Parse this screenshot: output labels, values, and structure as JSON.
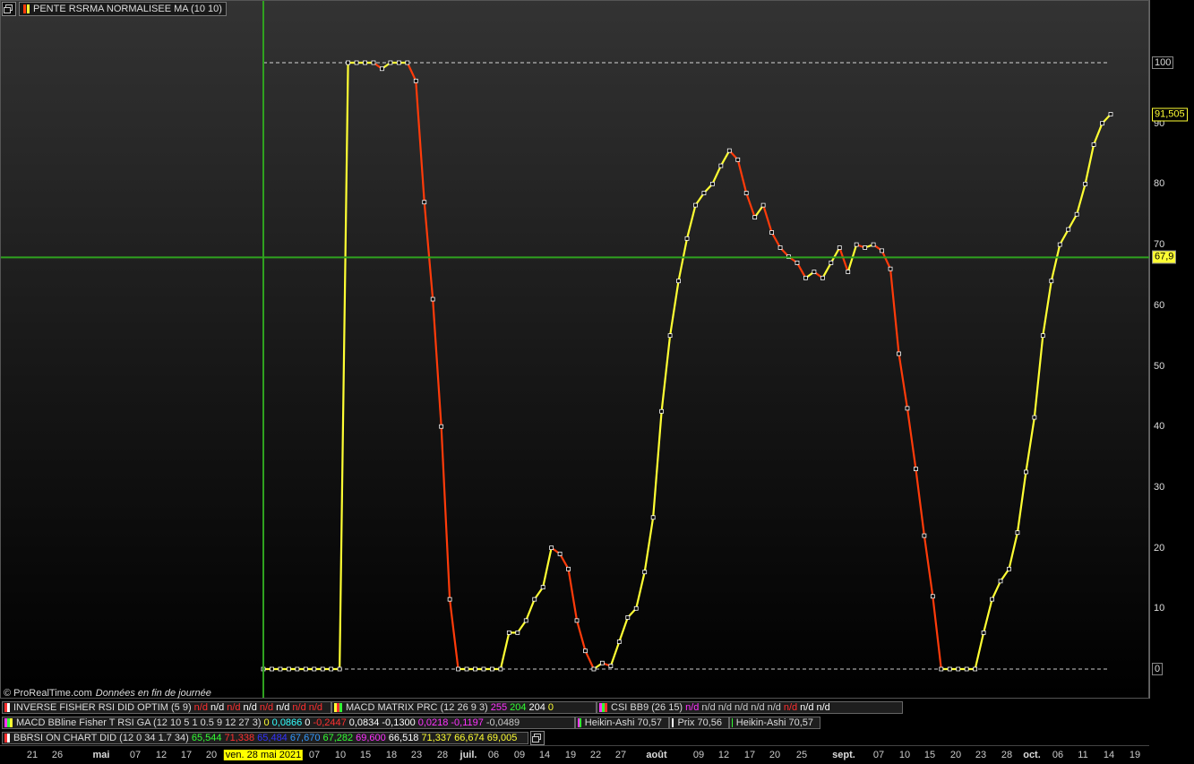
{
  "title": {
    "label": "PENTE RSRMA NORMALISEE MA (10 10)"
  },
  "copyright": {
    "brand": "© ProRealTime.com",
    "note": "Données en fin de journée"
  },
  "cursor": {
    "value_label": "67,9",
    "date_label": "ven. 28 mai 2021"
  },
  "last_value_label": "91,505",
  "colors": {
    "up": "#ffff33",
    "down": "#ff3b0a",
    "crosshair": "#2fa11f",
    "reference": "#ffffff"
  },
  "icons": {
    "window": "window-restore-icon"
  },
  "y_ticks": [
    "100",
    "90",
    "80",
    "70",
    "60",
    "50",
    "40",
    "30",
    "20",
    "10",
    "0"
  ],
  "x_ticks": [
    "21",
    "26",
    "mai",
    "07",
    "12",
    "17",
    "20",
    "ven. 28 mai 2021",
    "07",
    "10",
    "15",
    "18",
    "23",
    "28",
    "juil.",
    "06",
    "09",
    "14",
    "19",
    "22",
    "27",
    "août",
    "09",
    "12",
    "17",
    "20",
    "25",
    "sept.",
    "07",
    "10",
    "15",
    "20",
    "23",
    "28",
    "oct.",
    "06",
    "11",
    "14",
    "19"
  ],
  "indicators": {
    "row1": [
      {
        "name": "INVERSE FISHER RSI DID OPTIM (5 9)",
        "values": [
          {
            "v": "n/d",
            "c": "#ff3030"
          },
          {
            "v": "n/d",
            "c": "#ffffff"
          },
          {
            "v": "n/d",
            "c": "#ff3030"
          },
          {
            "v": "n/d",
            "c": "#ffffff"
          },
          {
            "v": "n/d",
            "c": "#ff3030"
          },
          {
            "v": "n/d",
            "c": "#ffffff"
          },
          {
            "v": "n/d",
            "c": "#ff3030"
          },
          {
            "v": "n/d",
            "c": "#ff3030"
          }
        ]
      },
      {
        "name": "MACD MATRIX PRC (12 26 9 3)",
        "values": [
          {
            "v": "255",
            "c": "#ff33ff"
          },
          {
            "v": "204",
            "c": "#33ff33"
          },
          {
            "v": "204",
            "c": "#ffffff"
          },
          {
            "v": "0",
            "c": "#ffff33"
          }
        ]
      },
      {
        "name": "CSI BB9 (26 15)",
        "values": [
          {
            "v": "n/d",
            "c": "#ff33ff"
          },
          {
            "v": "n/d",
            "c": "#cccccc"
          },
          {
            "v": "n/d",
            "c": "#cccccc"
          },
          {
            "v": "n/d",
            "c": "#cccccc"
          },
          {
            "v": "n/d",
            "c": "#cccccc"
          },
          {
            "v": "n/d",
            "c": "#cccccc"
          },
          {
            "v": "n/d",
            "c": "#ff3030"
          },
          {
            "v": "n/d",
            "c": "#ffffff"
          },
          {
            "v": "n/d",
            "c": "#ffffff"
          }
        ]
      }
    ],
    "row2": [
      {
        "name": "MACD  BBline  Fisher T RSI  GA (12 10 5 1 0.5 9 12 27 3)",
        "values": [
          {
            "v": "0",
            "c": "#ffff33"
          },
          {
            "v": "0,0866",
            "c": "#33ffff"
          },
          {
            "v": "0",
            "c": "#ffffff"
          },
          {
            "v": "-0,2447",
            "c": "#ff3030"
          },
          {
            "v": "0,0834",
            "c": "#ffffff"
          },
          {
            "v": "-0,1300",
            "c": "#ffffff"
          },
          {
            "v": "0,0218",
            "c": "#ff33ff"
          },
          {
            "v": "-0,1197",
            "c": "#ff33ff"
          },
          {
            "v": "-0,0489",
            "c": "#cccccc"
          }
        ]
      },
      {
        "name": "Heikin-Ashi 70,57",
        "values": []
      },
      {
        "name": "Prix 70,56",
        "values": []
      },
      {
        "name": "Heikin-Ashi 70,57",
        "values": []
      }
    ],
    "row3": [
      {
        "name": "BBRSI ON CHART DID (12 0 34 1.7 34)",
        "values": [
          {
            "v": "65,544",
            "c": "#33ff33"
          },
          {
            "v": "71,338",
            "c": "#ff3030"
          },
          {
            "v": "65,484",
            "c": "#3333ff"
          },
          {
            "v": "67,670",
            "c": "#3399ff"
          },
          {
            "v": "67,282",
            "c": "#33ff33"
          },
          {
            "v": "69,600",
            "c": "#ff33ff"
          },
          {
            "v": "66,518",
            "c": "#ffffff"
          },
          {
            "v": "71,337",
            "c": "#ffff33"
          },
          {
            "v": "66,674",
            "c": "#ffff33"
          },
          {
            "v": "69,005",
            "c": "#ffff33"
          }
        ]
      }
    ]
  },
  "chart_data": {
    "type": "line",
    "title": "PENTE RSRMA NORMALISEE MA (10 10)",
    "ylim": [
      0,
      100
    ],
    "reference_lines": [
      100,
      0
    ],
    "crosshair": {
      "y": 67.9,
      "date": "ven. 28 mai 2021"
    },
    "series": [
      {
        "values": [
          0,
          0,
          0,
          0,
          0,
          0,
          0,
          0,
          0,
          0,
          100,
          100,
          100,
          100,
          99,
          100,
          100,
          100,
          97,
          77,
          61,
          40,
          11.5,
          0,
          0,
          0,
          0,
          0,
          0,
          6,
          6,
          8,
          11.5,
          13.5,
          20,
          19,
          16.5,
          8,
          3,
          0,
          1,
          0.5,
          4.5,
          8.5,
          10,
          16,
          25,
          42.5,
          55,
          64,
          71,
          76.5,
          78.5,
          80,
          83,
          85.5,
          84,
          78.5,
          74.5,
          76.5,
          72,
          69.5,
          68,
          67,
          64.5,
          65.5,
          64.5,
          67,
          69.5,
          65.5,
          70,
          69.5,
          70,
          69,
          66,
          52,
          43,
          33,
          22,
          12,
          0,
          0,
          0,
          0,
          0,
          6,
          11.5,
          14.5,
          16.5,
          22.5,
          32.5,
          41.5,
          55,
          64,
          70,
          72.5,
          75,
          80,
          86.5,
          90,
          91.505
        ]
      }
    ]
  }
}
